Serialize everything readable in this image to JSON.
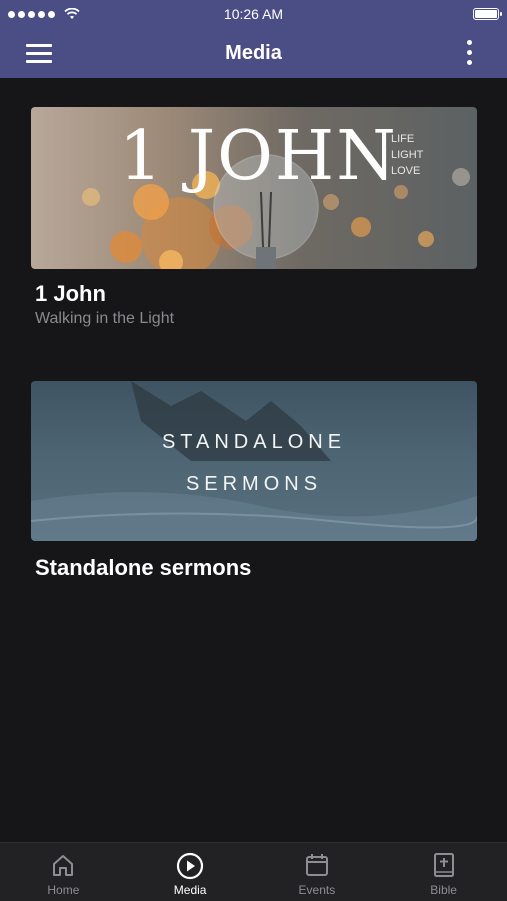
{
  "status_bar": {
    "time": "10:26 AM"
  },
  "navbar": {
    "title": "Media"
  },
  "series": [
    {
      "title": "1 John",
      "subtitle": "Walking in the Light",
      "artwork": {
        "big_text": "1 JOHN",
        "small_lines": [
          "LIFE",
          "LIGHT",
          "LOVE"
        ]
      }
    },
    {
      "title": "Standalone sermons",
      "artwork": {
        "lines": [
          "STANDALONE",
          "SERMONS"
        ]
      }
    }
  ],
  "tabs": [
    {
      "label": "Home",
      "icon": "home-icon",
      "active": false
    },
    {
      "label": "Media",
      "icon": "play-circle-icon",
      "active": true
    },
    {
      "label": "Events",
      "icon": "calendar-icon",
      "active": false
    },
    {
      "label": "Bible",
      "icon": "bible-icon",
      "active": false
    }
  ],
  "colors": {
    "header": "#4b4e85",
    "background": "#161618",
    "tabbar": "#222225"
  }
}
